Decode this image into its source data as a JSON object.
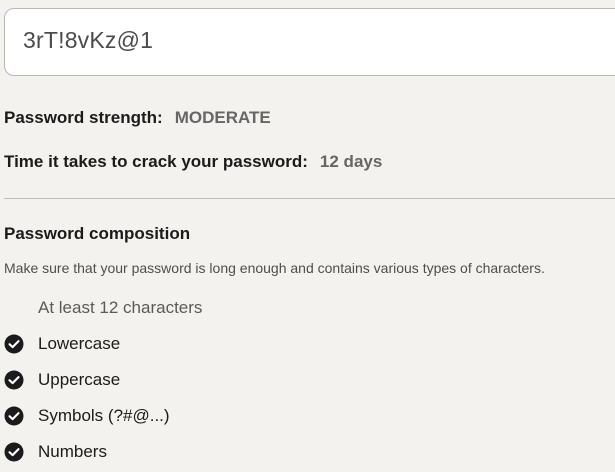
{
  "password_field": {
    "value": "3rT!8vKz@1"
  },
  "results": {
    "strength_label": "Password strength:",
    "strength_value": "MODERATE",
    "crack_label": "Time it takes to crack your password:",
    "crack_value": "12 days"
  },
  "composition": {
    "title": "Password composition",
    "description": "Make sure that your password is long enough and contains various types of characters.",
    "items": [
      {
        "label": "At least 12 characters",
        "met": false
      },
      {
        "label": "Lowercase",
        "met": true,
        "icon": "check-circle-icon"
      },
      {
        "label": "Uppercase",
        "met": true,
        "icon": "check-circle-icon"
      },
      {
        "label": "Symbols (?#@...)",
        "met": true,
        "icon": "check-circle-icon"
      },
      {
        "label": "Numbers",
        "met": true,
        "icon": "check-circle-icon"
      }
    ]
  },
  "colors": {
    "background": "#f3f2ee",
    "text_primary": "#1b1b1b",
    "text_secondary": "#666666",
    "border": "#b7b7b7",
    "check_fill": "#1b1b1b"
  }
}
